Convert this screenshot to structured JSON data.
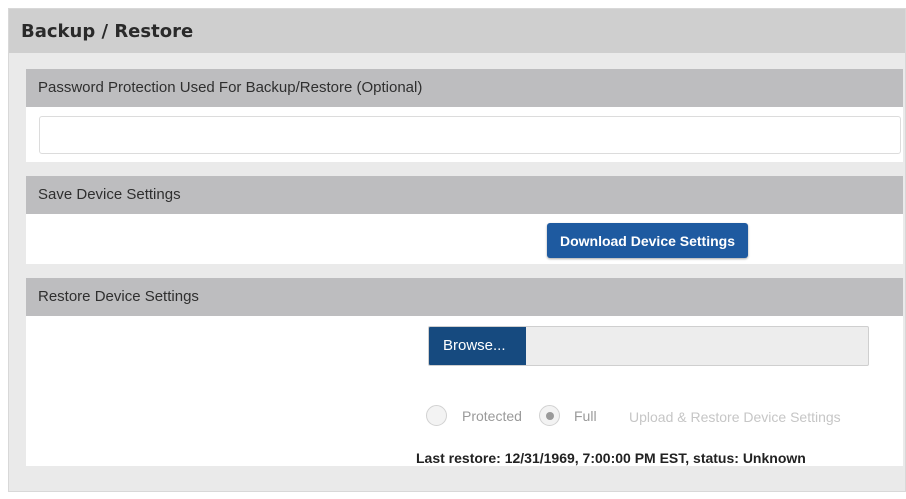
{
  "page": {
    "title": "Backup / Restore"
  },
  "password_panel": {
    "header": "Password Protection Used For Backup/Restore (Optional)",
    "input_value": ""
  },
  "save_panel": {
    "header": "Save Device Settings",
    "download_button": "Download Device Settings"
  },
  "restore_panel": {
    "header": "Restore Device Settings",
    "browse_button": "Browse...",
    "file_name": "",
    "radio_protected": "Protected",
    "radio_full": "Full",
    "selected_mode": "Full",
    "upload_button": "Upload & Restore Device Settings",
    "last_restore": "Last restore: 12/31/1969, 7:00:00 PM EST, status: Unknown"
  },
  "colors": {
    "primary_button": "#1e5aa0",
    "browse_button": "#164a7f",
    "panel_header": "#bdbdbf",
    "page_header": "#cfcfcf",
    "disabled_text": "#c6c6c6"
  }
}
